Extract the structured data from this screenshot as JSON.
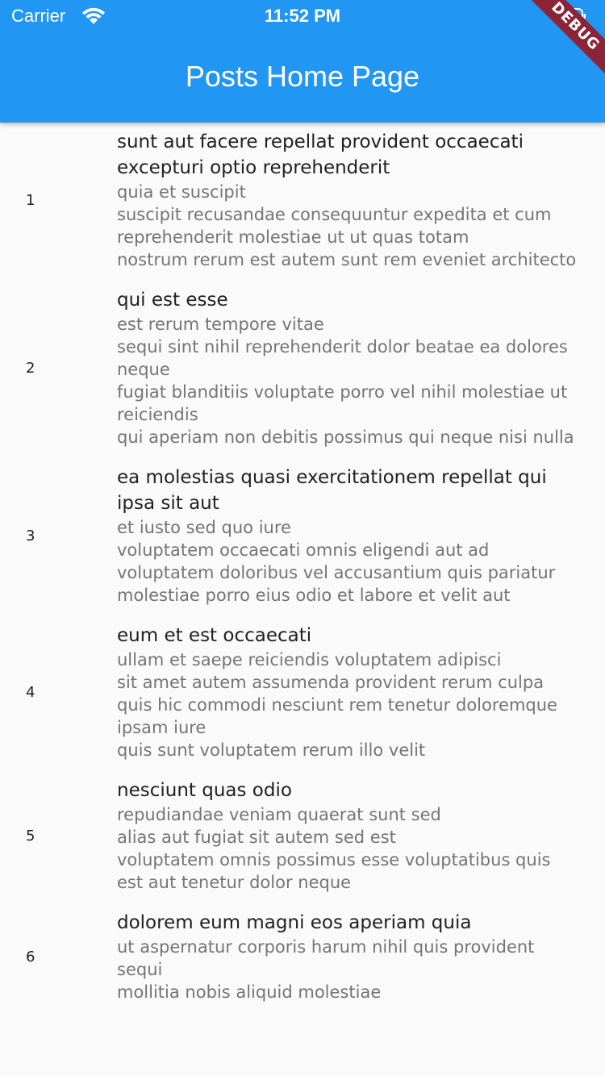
{
  "status_bar": {
    "carrier": "Carrier",
    "time": "11:52 PM",
    "wifi_icon": "wifi-icon",
    "battery_icon": "battery-icon"
  },
  "app_bar": {
    "title": "Posts Home Page",
    "color": "#2196f3"
  },
  "debug_banner": "DEBUG",
  "posts": [
    {
      "id": "1",
      "title": "sunt aut facere repellat provident occaecati excepturi optio reprehenderit",
      "body": "quia et suscipit\nsuscipit recusandae consequuntur expedita et cum\nreprehenderit molestiae ut ut quas totam\nnostrum rerum est autem sunt rem eveniet architecto"
    },
    {
      "id": "2",
      "title": "qui est esse",
      "body": "est rerum tempore vitae\nsequi sint nihil reprehenderit dolor beatae ea dolores neque\nfugiat blanditiis voluptate porro vel nihil molestiae ut reiciendis\nqui aperiam non debitis possimus qui neque nisi nulla"
    },
    {
      "id": "3",
      "title": "ea molestias quasi exercitationem repellat qui ipsa sit aut",
      "body": "et iusto sed quo iure\nvoluptatem occaecati omnis eligendi aut ad\nvoluptatem doloribus vel accusantium quis pariatur\nmolestiae porro eius odio et labore et velit aut"
    },
    {
      "id": "4",
      "title": "eum et est occaecati",
      "body": "ullam et saepe reiciendis voluptatem adipisci\nsit amet autem assumenda provident rerum culpa\nquis hic commodi nesciunt rem tenetur doloremque ipsam iure\nquis sunt voluptatem rerum illo velit"
    },
    {
      "id": "5",
      "title": "nesciunt quas odio",
      "body": "repudiandae veniam quaerat sunt sed\nalias aut fugiat sit autem sed est\nvoluptatem omnis possimus esse voluptatibus quis\nest aut tenetur dolor neque"
    },
    {
      "id": "6",
      "title": "dolorem eum magni eos aperiam quia",
      "body": "ut aspernatur corporis harum nihil quis provident sequi\nmollitia nobis aliquid molestiae"
    }
  ]
}
